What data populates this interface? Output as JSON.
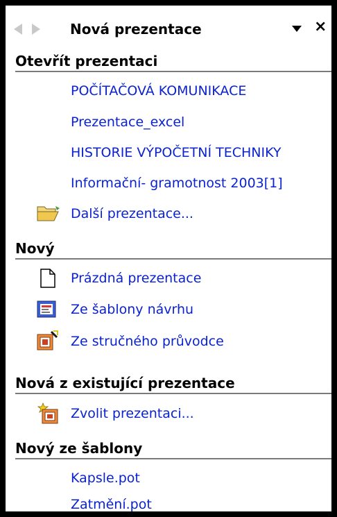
{
  "header": {
    "title": "Nová prezentace",
    "back_icon": "back-arrow-icon",
    "forward_icon": "forward-arrow-icon",
    "dropdown_icon": "chevron-down-icon",
    "close_glyph": "×"
  },
  "sections": {
    "open": {
      "title": "Otevřít prezentaci",
      "items": [
        "POČÍTAČOVÁ KOMUNIKACE",
        "Prezentace_excel",
        "HISTORIE VÝPOČETNÍ TECHNIKY",
        "Informační- gramotnost 2003[1]"
      ],
      "more_label": "Další prezentace..."
    },
    "new": {
      "title": "Nový",
      "blank_label": "Prázdná prezentace",
      "design_template_label": "Ze šablony návrhu",
      "wizard_label": "Ze stručného průvodce"
    },
    "from_existing": {
      "title": "Nová z existující prezentace",
      "choose_label": "Zvolit prezentaci..."
    },
    "from_template": {
      "title": "Nový ze šablony",
      "items": [
        "Kapsle.pot",
        "Zatmění.pot"
      ]
    }
  },
  "colors": {
    "link": "#0a22d0",
    "heading_rule": "#7a7a7a",
    "background": "#ffffff",
    "frame": "#000000"
  }
}
